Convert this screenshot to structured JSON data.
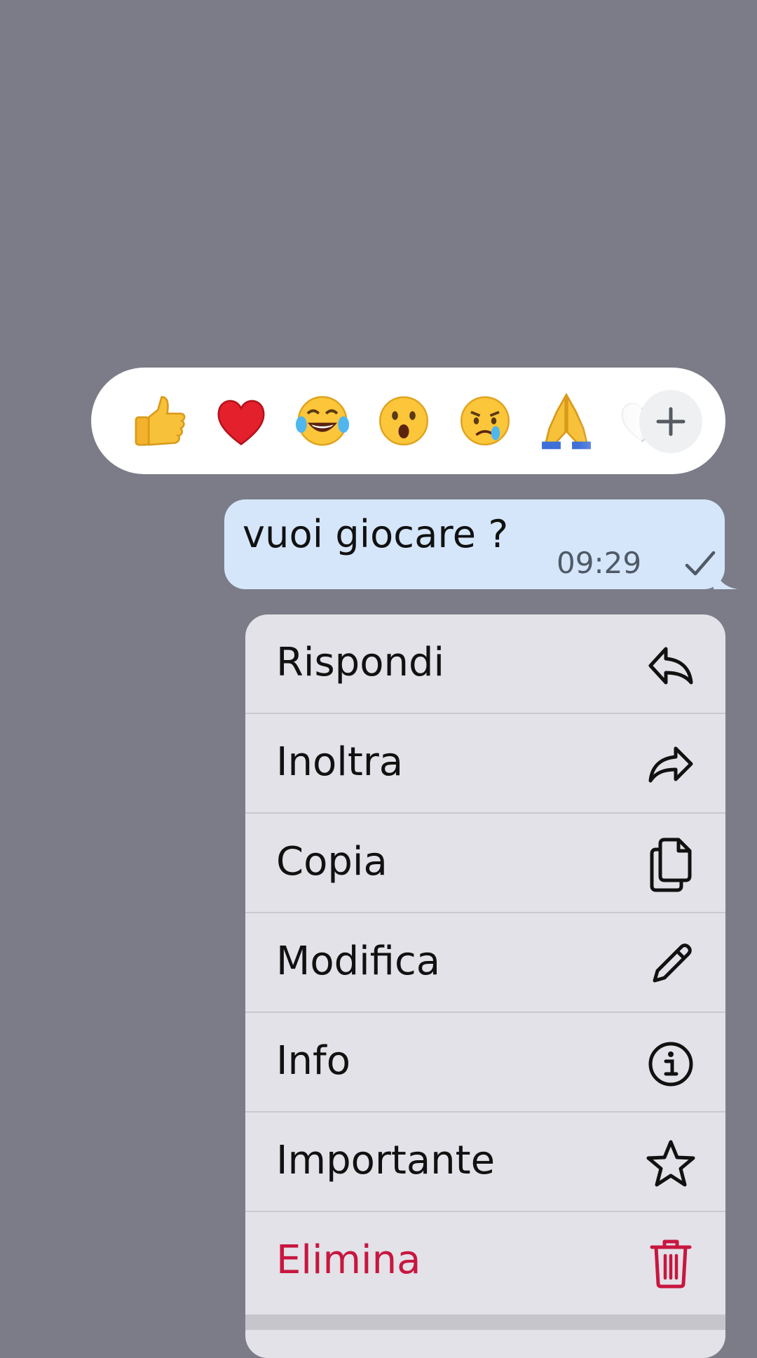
{
  "reactions": {
    "emojis": [
      {
        "name": "thumbs-up",
        "glyph": "👍"
      },
      {
        "name": "red-heart",
        "glyph": "❤️"
      },
      {
        "name": "tears-of-joy",
        "glyph": "😂"
      },
      {
        "name": "open-mouth",
        "glyph": "😮"
      },
      {
        "name": "crying-face",
        "glyph": "😢"
      },
      {
        "name": "folded-hands",
        "glyph": "🙏"
      }
    ],
    "more_icon": "plus-icon"
  },
  "message": {
    "text": "vuoi giocare ?",
    "time": "09:29",
    "status_icon": "single-check-icon",
    "bubble_color": "#d5e6fb"
  },
  "menu": {
    "items": [
      {
        "label": "Rispondi",
        "icon": "reply-icon"
      },
      {
        "label": "Inoltra",
        "icon": "forward-icon"
      },
      {
        "label": "Copia",
        "icon": "copy-icon"
      },
      {
        "label": "Modifica",
        "icon": "pencil-icon"
      },
      {
        "label": "Info",
        "icon": "info-icon"
      },
      {
        "label": "Importante",
        "icon": "star-icon"
      },
      {
        "label": "Elimina",
        "icon": "trash-icon"
      }
    ],
    "danger_color": "#c8163f"
  },
  "colors": {
    "backdrop": "#7c7c88",
    "menu_background": "#e2e2e8"
  }
}
